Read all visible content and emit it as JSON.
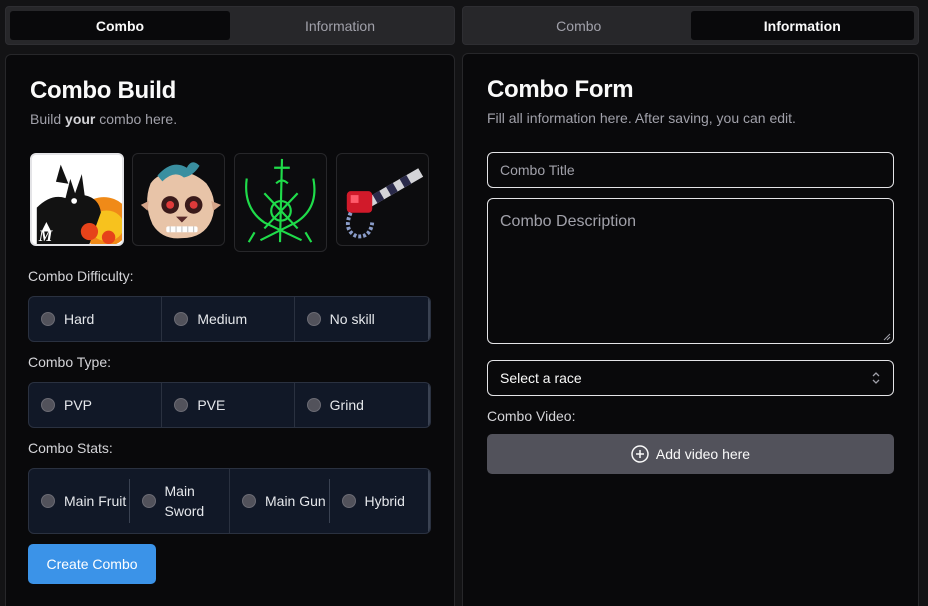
{
  "left_panel": {
    "tabs": [
      {
        "label": "Combo",
        "active": true
      },
      {
        "label": "Information",
        "active": false
      }
    ],
    "title": "Combo Build",
    "subtitle_pre": "Build ",
    "subtitle_bold": "your",
    "subtitle_post": " combo here.",
    "images": [
      {
        "name": "dark-creature-flame-image",
        "selected": true
      },
      {
        "name": "skull-creature-image",
        "selected": false
      },
      {
        "name": "green-crossed-swords-image",
        "selected": false
      },
      {
        "name": "red-gun-image",
        "selected": false
      }
    ],
    "difficulty": {
      "label": "Combo Difficulty:",
      "options": [
        "Hard",
        "Medium",
        "No skill"
      ]
    },
    "type": {
      "label": "Combo Type:",
      "options": [
        "PVP",
        "PVE",
        "Grind"
      ]
    },
    "stats": {
      "label": "Combo Stats:",
      "options": [
        "Main Fruit",
        "Main Sword",
        "Main Gun",
        "Hybrid"
      ]
    },
    "create_button": "Create Combo"
  },
  "right_panel": {
    "tabs": [
      {
        "label": "Combo",
        "active": false
      },
      {
        "label": "Information",
        "active": true
      }
    ],
    "title": "Combo Form",
    "subtitle": "Fill all information here. After saving, you can edit.",
    "title_placeholder": "Combo Title",
    "description_placeholder": "Combo Description",
    "race_select": "Select a race",
    "video_label": "Combo Video:",
    "video_button": "Add video here"
  },
  "colors": {
    "accent": "#3b93e8",
    "background": "#09090b",
    "radio_group_bg": "#111827"
  }
}
